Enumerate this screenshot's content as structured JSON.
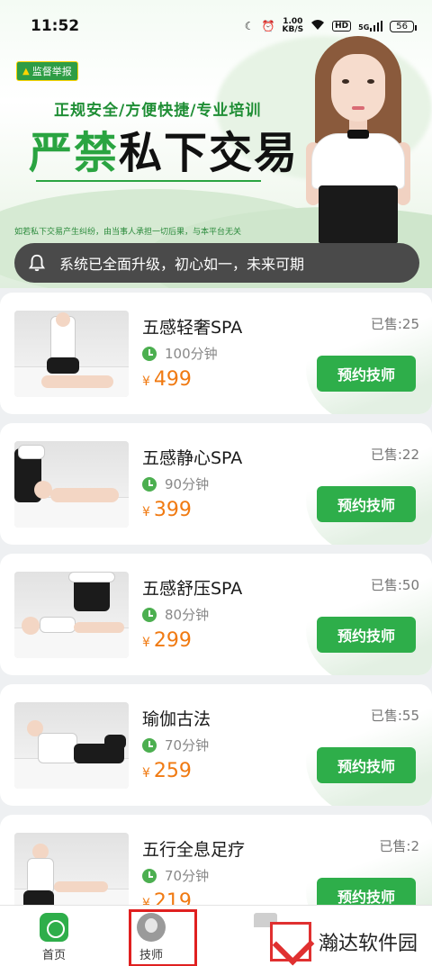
{
  "status_bar": {
    "time": "11:52",
    "speed_value": "1.00",
    "speed_unit": "KB/S",
    "hd": "HD",
    "network": "5G",
    "battery": "56"
  },
  "banner": {
    "report_label": "监督举报",
    "slogan": "正规安全/方便快捷/专业培训",
    "headline_strong": "严禁",
    "headline_rest": "私下交易",
    "disclaimer": "如若私下交易产生纠纷，由当事人承担一切后果，与本平台无关"
  },
  "notice": {
    "text": "系统已全面升级，初心如一，未来可期"
  },
  "services": [
    {
      "title": "五感轻奢SPA",
      "duration": "100分钟",
      "currency": "¥",
      "price": "499",
      "sold": "已售:25",
      "button": "预约技师"
    },
    {
      "title": "五感静心SPA",
      "duration": "90分钟",
      "currency": "¥",
      "price": "399",
      "sold": "已售:22",
      "button": "预约技师"
    },
    {
      "title": "五感舒压SPA",
      "duration": "80分钟",
      "currency": "¥",
      "price": "299",
      "sold": "已售:50",
      "button": "预约技师"
    },
    {
      "title": "瑜伽古法",
      "duration": "70分钟",
      "currency": "¥",
      "price": "259",
      "sold": "已售:55",
      "button": "预约技师"
    },
    {
      "title": "五行全息足疗",
      "duration": "70分钟",
      "currency": "¥",
      "price": "219",
      "sold": "已售:2",
      "button": "预约技师"
    }
  ],
  "tabbar": {
    "home": "首页",
    "technician": "技师"
  },
  "watermark": {
    "text": "瀚达软件园"
  },
  "colors": {
    "accent": "#2eae4a",
    "price": "#f07a12",
    "notice_bg": "#4a4a4a",
    "highlight_frame": "#e02020"
  }
}
